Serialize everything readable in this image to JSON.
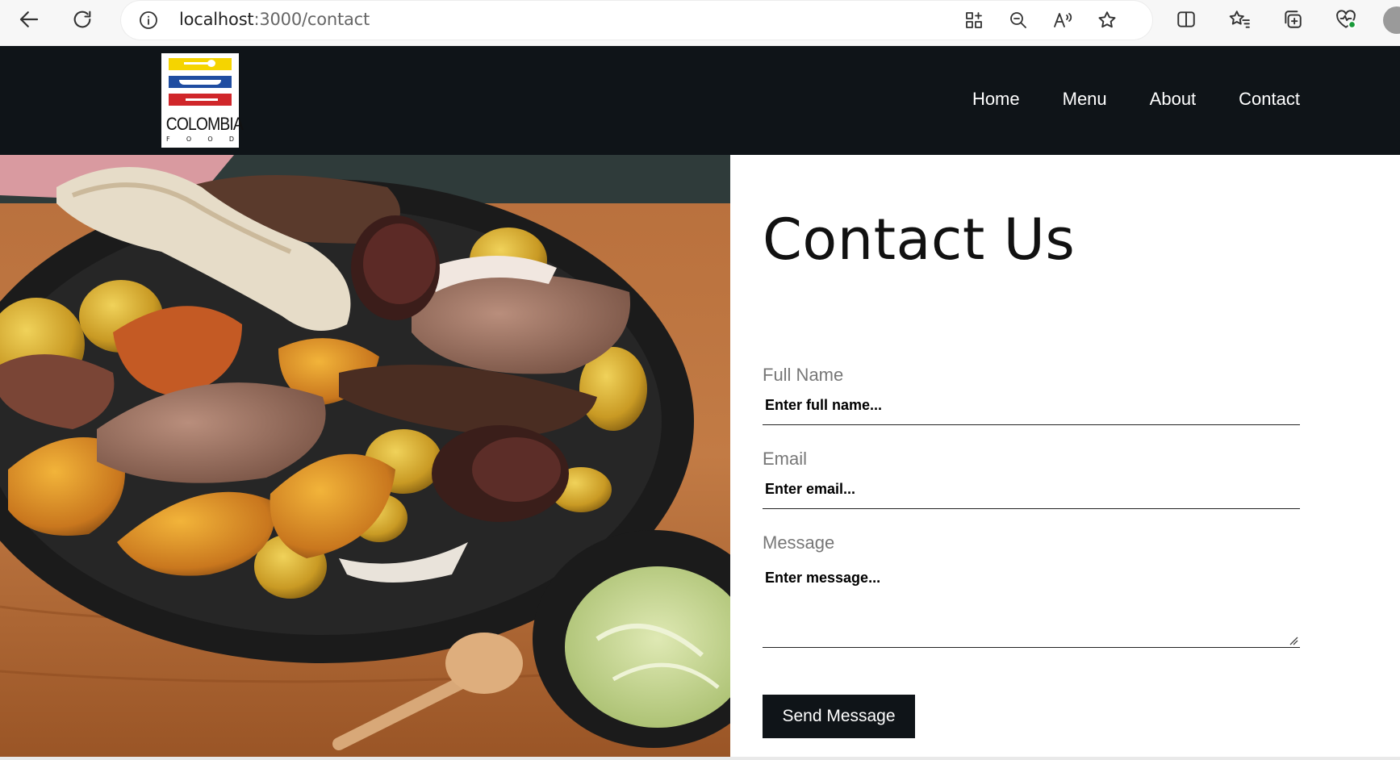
{
  "browser": {
    "url_host": "localhost",
    "url_rest": ":3000/contact"
  },
  "site": {
    "logo": {
      "wordmark": "COLOMBIA",
      "sub": [
        "F",
        "O",
        "O",
        "D"
      ]
    },
    "nav": [
      "Home",
      "Menu",
      "About",
      "Contact"
    ]
  },
  "contact": {
    "title": "Contact Us",
    "fields": {
      "name": {
        "label": "Full Name",
        "placeholder": "Enter full name..."
      },
      "email": {
        "label": "Email",
        "placeholder": "Enter email..."
      },
      "message": {
        "label": "Message",
        "placeholder": "Enter message..."
      }
    },
    "submit_label": "Send Message"
  },
  "colors": {
    "navbar_bg": "#0f1418",
    "button_bg": "#0f1418"
  },
  "icons": [
    "back-icon",
    "reload-icon",
    "info-icon",
    "apps-icon",
    "zoom-out-icon",
    "read-aloud-icon",
    "favorite-icon",
    "split-screen-icon",
    "favorites-icon",
    "collections-icon",
    "browser-essentials-icon",
    "profile-avatar"
  ]
}
